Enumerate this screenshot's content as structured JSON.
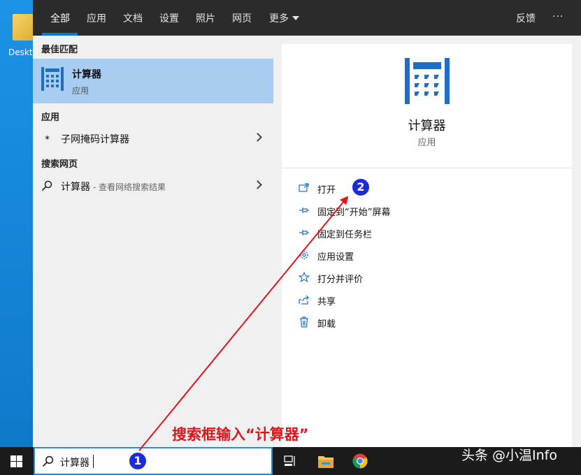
{
  "desktop": {
    "icon_label": "Desktop"
  },
  "tabs": [
    {
      "label": "全部",
      "active": true
    },
    {
      "label": "应用"
    },
    {
      "label": "文档"
    },
    {
      "label": "设置"
    },
    {
      "label": "照片"
    },
    {
      "label": "网页"
    },
    {
      "label": "更多"
    }
  ],
  "topbar": {
    "feedback_label": "反馈",
    "more_label": "···"
  },
  "left": {
    "best_match_heading": "最佳匹配",
    "best_match": {
      "title": "计算器",
      "subtitle": "应用"
    },
    "apps_heading": "应用",
    "app_item": "子网掩码计算器",
    "web_heading": "搜索网页",
    "web_item": {
      "query": "计算器",
      "hint": " - 查看网络搜索结果"
    }
  },
  "right": {
    "title": "计算器",
    "subtitle": "应用",
    "actions": [
      {
        "label": "打开",
        "icon": "open-icon"
      },
      {
        "label": "固定到“开始”屏幕",
        "icon": "pin-icon"
      },
      {
        "label": "固定到任务栏",
        "icon": "pin-icon"
      },
      {
        "label": "应用设置",
        "icon": "gear-icon"
      },
      {
        "label": "打分并评价",
        "icon": "star-icon"
      },
      {
        "label": "共享",
        "icon": "share-icon"
      },
      {
        "label": "卸载",
        "icon": "trash-icon"
      }
    ]
  },
  "taskbar": {
    "search_value": "计算器"
  },
  "annotation": {
    "text": "搜索框输入“计算器”",
    "badge1": "1",
    "badge2": "2",
    "color": "#e0141c"
  },
  "watermark": "头条 @小温Info",
  "colors": {
    "accent": "#0a78d7",
    "highlight": "#a8cdf0",
    "calc_blue": "#1e6fc4"
  }
}
